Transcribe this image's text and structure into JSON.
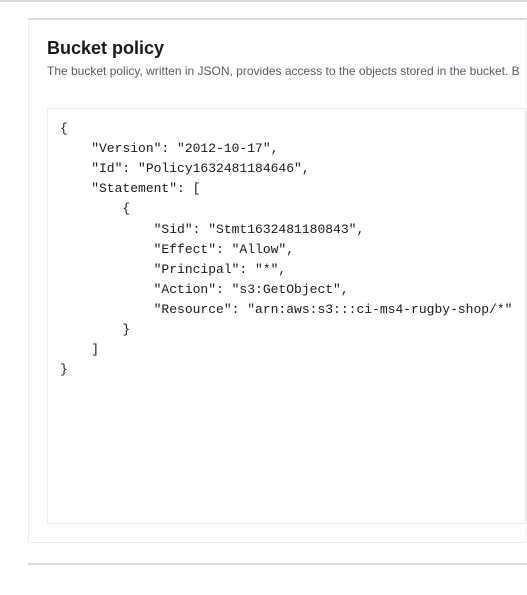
{
  "section": {
    "title": "Bucket policy",
    "description": "The bucket policy, written in JSON, provides access to the objects stored in the bucket. B"
  },
  "policy": {
    "Version": "2012-10-17",
    "Id": "Policy1632481184646",
    "Statement": [
      {
        "Sid": "Stmt1632481180843",
        "Effect": "Allow",
        "Principal": "*",
        "Action": "s3:GetObject",
        "Resource": "arn:aws:s3:::ci-ms4-rugby-shop/*"
      }
    ]
  }
}
